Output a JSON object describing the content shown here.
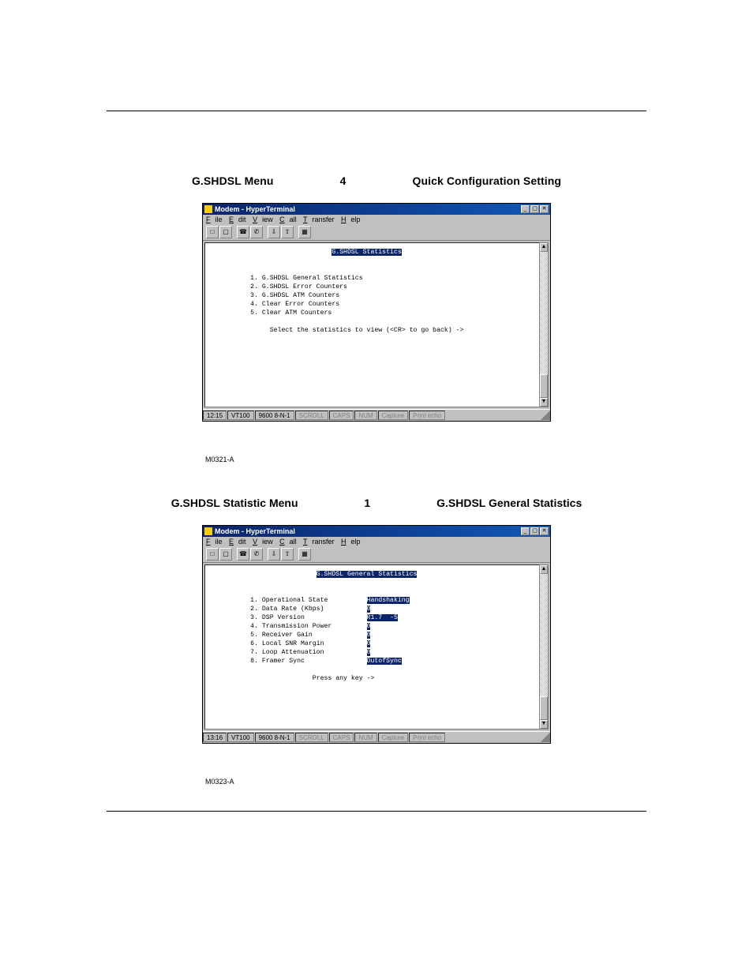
{
  "captions": {
    "c1_left": "G.SHDSL Menu",
    "c1_mid": "4",
    "c1_right": "Quick Configuration Setting",
    "c2_left": "G.SHDSL Statistic Menu",
    "c2_mid": "1",
    "c2_right": "G.SHDSL General Statistics"
  },
  "window": {
    "title": "Modem - HyperTerminal",
    "menu": {
      "file": "File",
      "edit": "Edit",
      "view": "View",
      "call": "Call",
      "transfer": "Transfer",
      "help": "Help"
    },
    "ctrl": {
      "min": "_",
      "max": "▢",
      "close": "✕"
    }
  },
  "status": {
    "label1": "M0321-A",
    "time1": "12:15",
    "label2": "M0323-A",
    "time2": "13:16",
    "emul": "VT100",
    "port": "9600 8-N-1",
    "scroll": "SCROLL",
    "caps": "CAPS",
    "num": "NUM",
    "capture": "Capture",
    "print": "Print echo"
  },
  "term1": {
    "header": "G.SHDSL Statistics",
    "l1": "1. G.SHDSL General Statistics",
    "l2": "2. G.SHDSL Error Counters",
    "l3": "3. G.SHDSL ATM Counters",
    "l4": "4. Clear Error Counters",
    "l5": "5. Clear ATM Counters",
    "prompt": "Select the statistics to view (<CR> to go back) ->"
  },
  "term2": {
    "header": "G.SHDSL General Statistics",
    "rows": [
      {
        "n": "1.",
        "k": "Operational State",
        "v": "Handshaking"
      },
      {
        "n": "2.",
        "k": "Data Rate (Kbps)",
        "v": "0"
      },
      {
        "n": "3.",
        "k": "DSP Version",
        "v": "R1.7  -5"
      },
      {
        "n": "4.",
        "k": "Transmission Power",
        "v": "0"
      },
      {
        "n": "5.",
        "k": "Receiver Gain",
        "v": "0"
      },
      {
        "n": "6.",
        "k": "Local SNR Margin",
        "v": "0"
      },
      {
        "n": "7.",
        "k": "Loop Attenuation",
        "v": "0"
      },
      {
        "n": "8.",
        "k": "Framer Sync",
        "v": "OutofSync"
      }
    ],
    "prompt": "Press any key ->"
  }
}
